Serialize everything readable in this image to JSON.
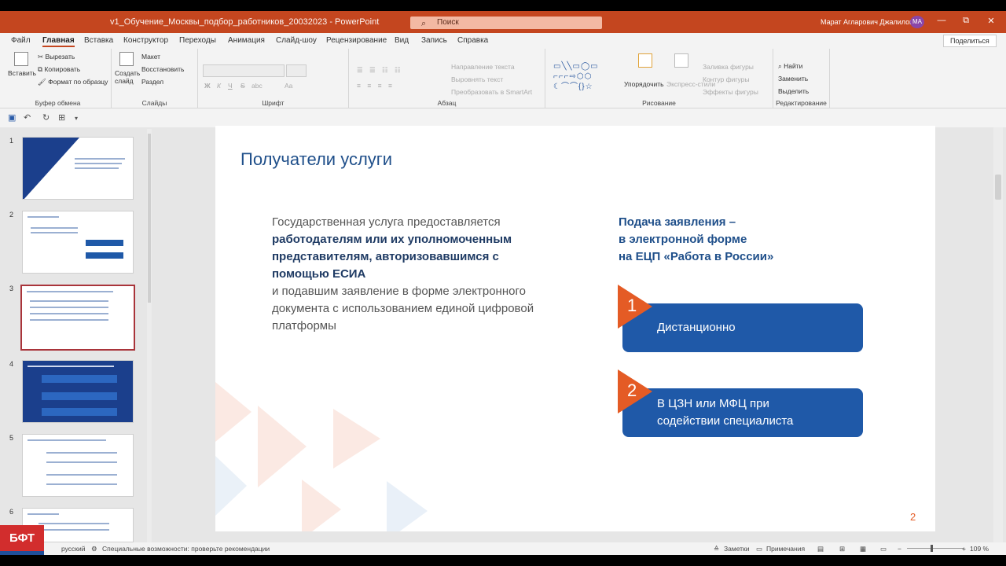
{
  "window": {
    "title": "v1_Обучение_Москвы_подбор_работников_20032023 - PowerPoint",
    "search_placeholder": "Поиск",
    "user_name": "Марат Агларович Джалилов",
    "user_initials": "МА",
    "minimize": "—",
    "restore": "⧉",
    "close": "✕"
  },
  "tabs": [
    "Файл",
    "Главная",
    "Вставка",
    "Конструктор",
    "Переходы",
    "Анимация",
    "Слайд-шоу",
    "Рецензирование",
    "Вид",
    "Запись",
    "Справка"
  ],
  "share_label": "Поделиться",
  "ribbon": {
    "clipboard": {
      "paste": "Вставить",
      "cut": "Вырезать",
      "copy": "Копировать",
      "format_painter": "Формат по образцу",
      "label": "Буфер обмена"
    },
    "slides": {
      "new_slide": "Создать слайд",
      "layout": "Макет",
      "reset": "Восстановить",
      "section": "Раздел",
      "label": "Слайды"
    },
    "font": {
      "label": "Шрифт",
      "bold": "Ж",
      "italic": "К",
      "underline": "Ч",
      "strike": "S",
      "shadow": "abc",
      "case": "Aa"
    },
    "paragraph": {
      "text_direction": "Направление текста",
      "align_text": "Выровнять текст",
      "smartart": "Преобразовать в SmartArt",
      "label": "Абзац"
    },
    "drawing": {
      "arrange": "Упорядочить",
      "quick_styles": "Экспресс-стили",
      "shape_fill": "Заливка фигуры",
      "shape_outline": "Контур фигуры",
      "shape_effects": "Эффекты фигуры",
      "label": "Рисование"
    },
    "editing": {
      "find": "Найти",
      "replace": "Заменить",
      "select": "Выделить",
      "label": "Редактирование"
    }
  },
  "thumbnails": [
    {
      "num": "1",
      "text": "Оказание государственной услуги по содействию работодателям в подборе необходимых работников"
    },
    {
      "num": "2",
      "text": "Нормативная база"
    },
    {
      "num": "3",
      "text": "Сокращение числа мест, необходимых для получения государственных услуг"
    },
    {
      "num": "4",
      "text": "Перечень документов, необходимых для получения услуги"
    },
    {
      "num": "5",
      "text": "Перечень документов и сведений, необходимых для предоставления государственной услуги"
    },
    {
      "num": "6",
      "text": "Отбор по заявке"
    }
  ],
  "slide": {
    "title": "Получатели услуги",
    "body_intro": "Государственная услуга предоставляется",
    "body_bold": "работодателям или их уполномоченным представителям, авторизовавшимся с помощью ЕСИА",
    "body_rest": "и подавшим заявление в форме электронного документа с использованием единой цифровой платформы",
    "right_heading_1": "Подача заявления –",
    "right_heading_2": "в электронной форме",
    "right_heading_3": "на ЕЦП «Работа в России»",
    "card1_num": "1",
    "card1_text": "Дистанционно",
    "card2_num": "2",
    "card2_line1": "В ЦЗН или МФЦ при",
    "card2_line2": "содействии специалиста",
    "page_number": "2"
  },
  "status": {
    "language": "русский",
    "accessibility": "Специальные возможности: проверьте рекомендации",
    "notes": "Заметки",
    "comments": "Примечания",
    "zoom": "109 %"
  },
  "logo_text": "БФТ",
  "colors": {
    "titlebar": "#c4461f",
    "slide_blue": "#1f59a8",
    "accent_orange": "#e45b25"
  }
}
